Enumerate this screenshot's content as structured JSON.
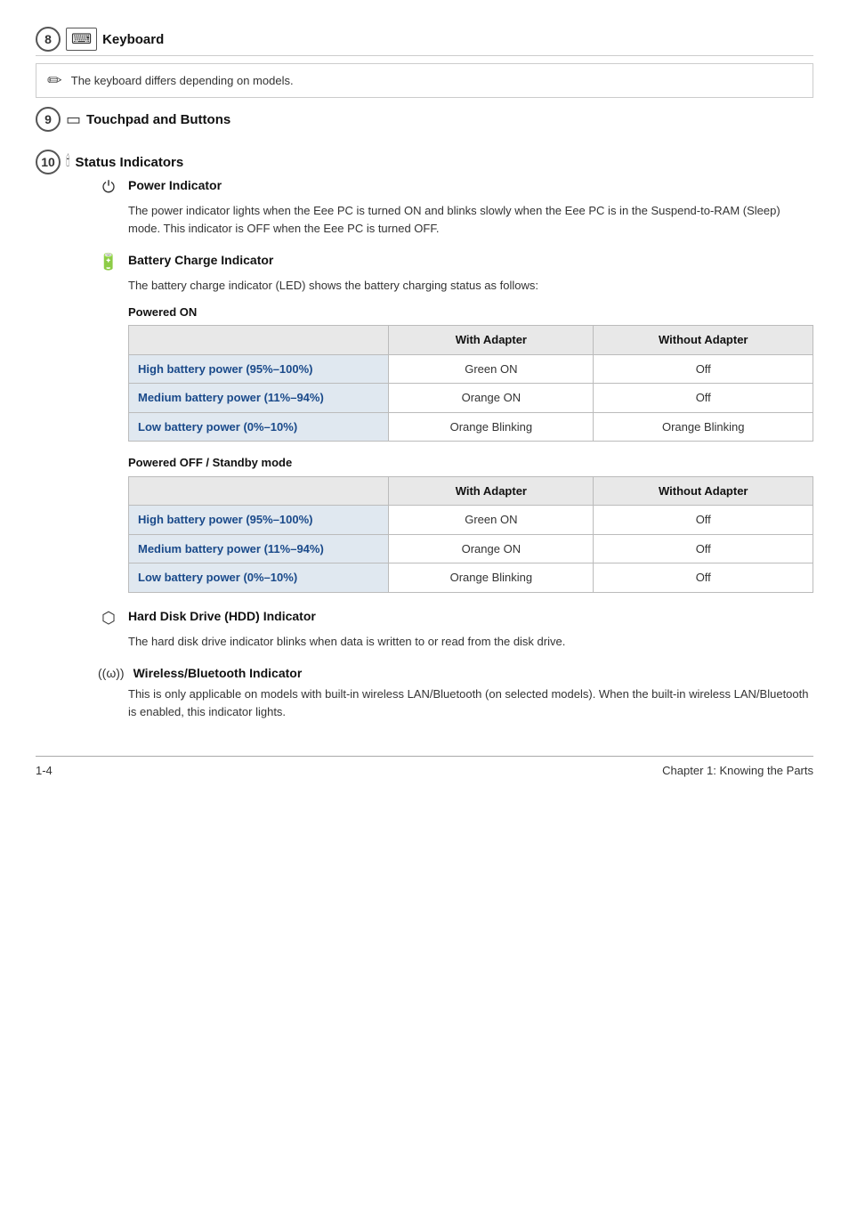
{
  "sections": {
    "keyboard": {
      "number": "8",
      "icon": "⌨",
      "title": "Keyboard",
      "note": "The keyboard differs depending on models."
    },
    "touchpad": {
      "number": "9",
      "icon": "▭",
      "title": "Touchpad and Buttons"
    },
    "status_indicators": {
      "number": "10",
      "icon": "🕯",
      "title": "Status Indicators",
      "power_indicator": {
        "title": "Power Indicator",
        "text": "The power indicator lights when the Eee PC is turned ON and blinks slowly when the Eee PC is in the Suspend-to-RAM (Sleep) mode. This indicator is OFF when the Eee PC is turned OFF."
      },
      "battery_charge": {
        "title": "Battery Charge Indicator",
        "intro": "The battery charge indicator (LED) shows the battery charging status as follows:",
        "powered_on": {
          "label": "Powered ON",
          "col_header_1": "With Adapter",
          "col_header_2": "Without Adapter",
          "rows": [
            {
              "label": "High battery power (95%–100%)",
              "with_adapter": "Green ON",
              "without_adapter": "Off"
            },
            {
              "label": "Medium battery power (11%–94%)",
              "with_adapter": "Orange ON",
              "without_adapter": "Off"
            },
            {
              "label": "Low battery power (0%–10%)",
              "with_adapter": "Orange Blinking",
              "without_adapter": "Orange Blinking"
            }
          ]
        },
        "powered_off": {
          "label": "Powered OFF / Standby mode",
          "col_header_1": "With Adapter",
          "col_header_2": "Without Adapter",
          "rows": [
            {
              "label": "High battery power (95%–100%)",
              "with_adapter": "Green ON",
              "without_adapter": "Off"
            },
            {
              "label": "Medium battery power (11%–94%)",
              "with_adapter": "Orange ON",
              "without_adapter": "Off"
            },
            {
              "label": "Low battery power (0%–10%)",
              "with_adapter": "Orange Blinking",
              "without_adapter": "Off"
            }
          ]
        }
      },
      "hdd_indicator": {
        "title": "Hard Disk Drive (HDD) Indicator",
        "text": "The hard disk drive indicator blinks when data is written to or read from the disk drive."
      },
      "wireless_indicator": {
        "title": "Wireless/Bluetooth Indicator",
        "text": "This is only applicable on models with built-in wireless LAN/Bluetooth (on selected models). When the built-in wireless LAN/Bluetooth is enabled, this indicator lights."
      }
    }
  },
  "footer": {
    "page_num": "1-4",
    "chapter": "Chapter 1: Knowing the Parts"
  }
}
